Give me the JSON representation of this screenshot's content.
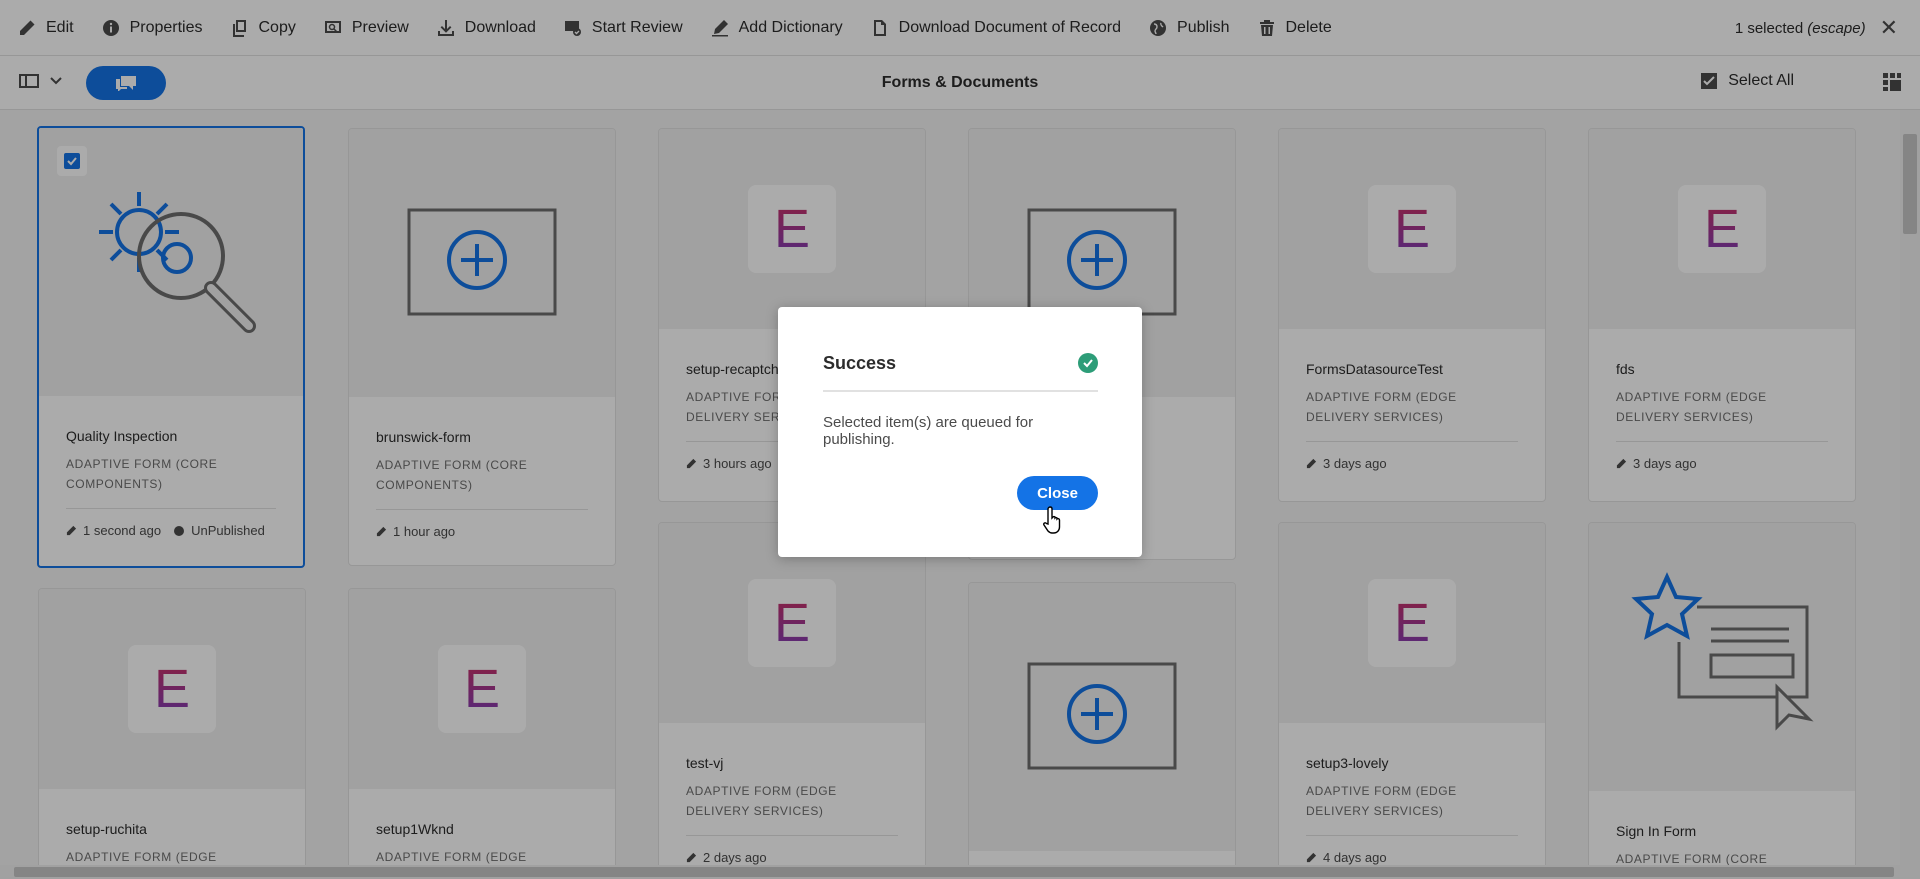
{
  "actionbar": {
    "actions": [
      {
        "label": "Edit",
        "icon": "pencil-icon"
      },
      {
        "label": "Properties",
        "icon": "info-icon"
      },
      {
        "label": "Copy",
        "icon": "copy-icon"
      },
      {
        "label": "Preview",
        "icon": "preview-icon"
      },
      {
        "label": "Download",
        "icon": "download-icon"
      },
      {
        "label": "Start Review",
        "icon": "review-icon"
      },
      {
        "label": "Add Dictionary",
        "icon": "dictionary-icon"
      },
      {
        "label": "Download Document of Record",
        "icon": "document-icon"
      },
      {
        "label": "Publish",
        "icon": "globe-icon"
      },
      {
        "label": "Delete",
        "icon": "trash-icon"
      }
    ],
    "selection_count": "1 selected",
    "selection_hint": "(escape)"
  },
  "titlebar": {
    "title": "Forms & Documents",
    "select_all": "Select All"
  },
  "cards": [
    {
      "name": "Quality Inspection",
      "type": "ADAPTIVE FORM (CORE COMPONENTS)",
      "modified": "1 second ago",
      "status": "UnPublished",
      "thumb": "gear-search",
      "selected": true
    },
    {
      "name": "brunswick-form",
      "type": "ADAPTIVE FORM (CORE COMPONENTS)",
      "modified": "1 hour ago",
      "thumb": "plus-frame"
    },
    {
      "name": "setup-recaptcha",
      "type": "ADAPTIVE FORM (EDGE DELIVERY SERVICES)",
      "modified": "3 hours ago",
      "thumb": "e-tile"
    },
    {
      "name": "",
      "type": "",
      "modified": "",
      "thumb": "plus-frame"
    },
    {
      "name": "FormsDatasourceTest",
      "type": "ADAPTIVE FORM (EDGE DELIVERY SERVICES)",
      "modified": "3 days ago",
      "thumb": "e-tile"
    },
    {
      "name": "fds",
      "type": "ADAPTIVE FORM (EDGE DELIVERY SERVICES)",
      "modified": "3 days ago",
      "thumb": "e-tile"
    },
    {
      "name": "setup-ruchita",
      "type": "ADAPTIVE FORM (EDGE DELIVERY",
      "thumb": "e-tile"
    },
    {
      "name": "setup1Wknd",
      "type": "ADAPTIVE FORM (EDGE DELIVERY",
      "thumb": "e-tile"
    },
    {
      "name": "test-vj",
      "type": "ADAPTIVE FORM (EDGE DELIVERY SERVICES)",
      "modified": "2 days ago",
      "thumb": "e-tile"
    },
    {
      "name": "",
      "type": "",
      "thumb": "plus-frame"
    },
    {
      "name": "setup3-lovely",
      "type": "ADAPTIVE FORM (EDGE DELIVERY SERVICES)",
      "modified": "4 days ago",
      "thumb": "e-tile"
    },
    {
      "name": "Sign In Form",
      "type": "ADAPTIVE FORM (CORE",
      "thumb": "star-form"
    }
  ],
  "thumb_letter": "E",
  "dialog": {
    "title": "Success",
    "message": "Selected item(s) are queued for publishing.",
    "close_label": "Close",
    "status_icon": "check-circle-icon"
  },
  "colors": {
    "accent": "#1473e6",
    "success": "#2d9d78"
  }
}
